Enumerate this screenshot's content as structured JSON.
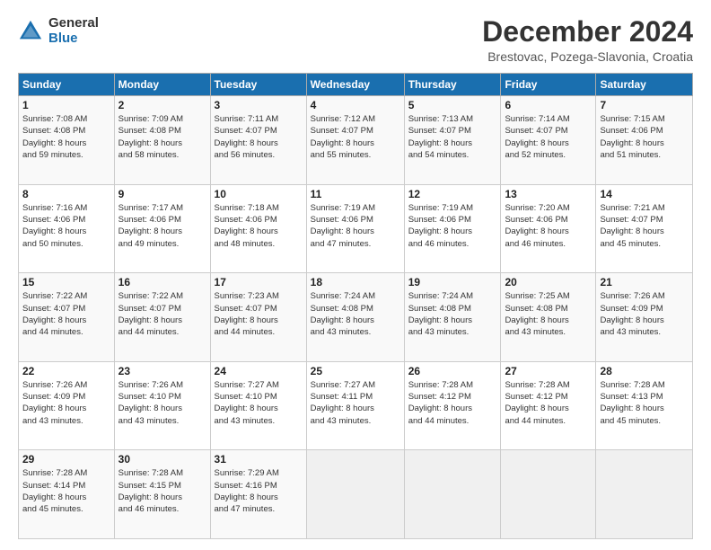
{
  "logo": {
    "general": "General",
    "blue": "Blue"
  },
  "title": "December 2024",
  "location": "Brestovac, Pozega-Slavonia, Croatia",
  "days_of_week": [
    "Sunday",
    "Monday",
    "Tuesday",
    "Wednesday",
    "Thursday",
    "Friday",
    "Saturday"
  ],
  "weeks": [
    [
      {
        "day": "1",
        "info": "Sunrise: 7:08 AM\nSunset: 4:08 PM\nDaylight: 8 hours\nand 59 minutes."
      },
      {
        "day": "2",
        "info": "Sunrise: 7:09 AM\nSunset: 4:08 PM\nDaylight: 8 hours\nand 58 minutes."
      },
      {
        "day": "3",
        "info": "Sunrise: 7:11 AM\nSunset: 4:07 PM\nDaylight: 8 hours\nand 56 minutes."
      },
      {
        "day": "4",
        "info": "Sunrise: 7:12 AM\nSunset: 4:07 PM\nDaylight: 8 hours\nand 55 minutes."
      },
      {
        "day": "5",
        "info": "Sunrise: 7:13 AM\nSunset: 4:07 PM\nDaylight: 8 hours\nand 54 minutes."
      },
      {
        "day": "6",
        "info": "Sunrise: 7:14 AM\nSunset: 4:07 PM\nDaylight: 8 hours\nand 52 minutes."
      },
      {
        "day": "7",
        "info": "Sunrise: 7:15 AM\nSunset: 4:06 PM\nDaylight: 8 hours\nand 51 minutes."
      }
    ],
    [
      {
        "day": "8",
        "info": "Sunrise: 7:16 AM\nSunset: 4:06 PM\nDaylight: 8 hours\nand 50 minutes."
      },
      {
        "day": "9",
        "info": "Sunrise: 7:17 AM\nSunset: 4:06 PM\nDaylight: 8 hours\nand 49 minutes."
      },
      {
        "day": "10",
        "info": "Sunrise: 7:18 AM\nSunset: 4:06 PM\nDaylight: 8 hours\nand 48 minutes."
      },
      {
        "day": "11",
        "info": "Sunrise: 7:19 AM\nSunset: 4:06 PM\nDaylight: 8 hours\nand 47 minutes."
      },
      {
        "day": "12",
        "info": "Sunrise: 7:19 AM\nSunset: 4:06 PM\nDaylight: 8 hours\nand 46 minutes."
      },
      {
        "day": "13",
        "info": "Sunrise: 7:20 AM\nSunset: 4:06 PM\nDaylight: 8 hours\nand 46 minutes."
      },
      {
        "day": "14",
        "info": "Sunrise: 7:21 AM\nSunset: 4:07 PM\nDaylight: 8 hours\nand 45 minutes."
      }
    ],
    [
      {
        "day": "15",
        "info": "Sunrise: 7:22 AM\nSunset: 4:07 PM\nDaylight: 8 hours\nand 44 minutes."
      },
      {
        "day": "16",
        "info": "Sunrise: 7:22 AM\nSunset: 4:07 PM\nDaylight: 8 hours\nand 44 minutes."
      },
      {
        "day": "17",
        "info": "Sunrise: 7:23 AM\nSunset: 4:07 PM\nDaylight: 8 hours\nand 44 minutes."
      },
      {
        "day": "18",
        "info": "Sunrise: 7:24 AM\nSunset: 4:08 PM\nDaylight: 8 hours\nand 43 minutes."
      },
      {
        "day": "19",
        "info": "Sunrise: 7:24 AM\nSunset: 4:08 PM\nDaylight: 8 hours\nand 43 minutes."
      },
      {
        "day": "20",
        "info": "Sunrise: 7:25 AM\nSunset: 4:08 PM\nDaylight: 8 hours\nand 43 minutes."
      },
      {
        "day": "21",
        "info": "Sunrise: 7:26 AM\nSunset: 4:09 PM\nDaylight: 8 hours\nand 43 minutes."
      }
    ],
    [
      {
        "day": "22",
        "info": "Sunrise: 7:26 AM\nSunset: 4:09 PM\nDaylight: 8 hours\nand 43 minutes."
      },
      {
        "day": "23",
        "info": "Sunrise: 7:26 AM\nSunset: 4:10 PM\nDaylight: 8 hours\nand 43 minutes."
      },
      {
        "day": "24",
        "info": "Sunrise: 7:27 AM\nSunset: 4:10 PM\nDaylight: 8 hours\nand 43 minutes."
      },
      {
        "day": "25",
        "info": "Sunrise: 7:27 AM\nSunset: 4:11 PM\nDaylight: 8 hours\nand 43 minutes."
      },
      {
        "day": "26",
        "info": "Sunrise: 7:28 AM\nSunset: 4:12 PM\nDaylight: 8 hours\nand 44 minutes."
      },
      {
        "day": "27",
        "info": "Sunrise: 7:28 AM\nSunset: 4:12 PM\nDaylight: 8 hours\nand 44 minutes."
      },
      {
        "day": "28",
        "info": "Sunrise: 7:28 AM\nSunset: 4:13 PM\nDaylight: 8 hours\nand 45 minutes."
      }
    ],
    [
      {
        "day": "29",
        "info": "Sunrise: 7:28 AM\nSunset: 4:14 PM\nDaylight: 8 hours\nand 45 minutes."
      },
      {
        "day": "30",
        "info": "Sunrise: 7:28 AM\nSunset: 4:15 PM\nDaylight: 8 hours\nand 46 minutes."
      },
      {
        "day": "31",
        "info": "Sunrise: 7:29 AM\nSunset: 4:16 PM\nDaylight: 8 hours\nand 47 minutes."
      },
      {
        "day": "",
        "info": ""
      },
      {
        "day": "",
        "info": ""
      },
      {
        "day": "",
        "info": ""
      },
      {
        "day": "",
        "info": ""
      }
    ]
  ]
}
